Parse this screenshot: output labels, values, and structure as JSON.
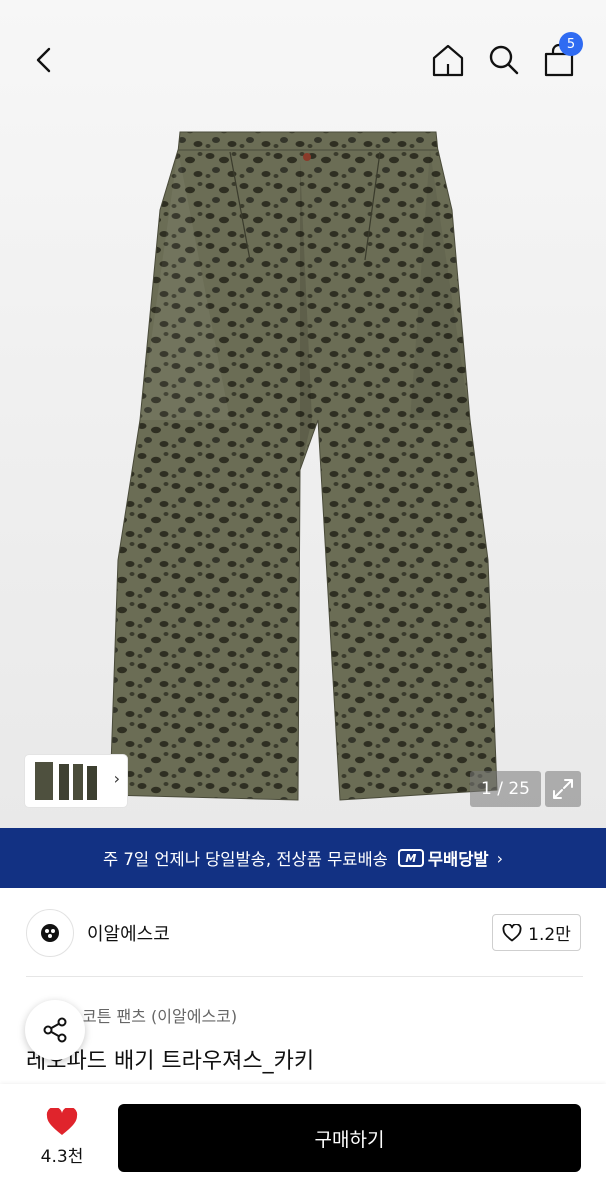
{
  "header": {
    "cart_count": "5"
  },
  "gallery": {
    "counter": "1 / 25"
  },
  "promo": {
    "text": "주 7일 언제나 당일발송, 전상품 무료배송",
    "badge_label": "무배당발"
  },
  "brand": {
    "name": "이알에스코",
    "likes": "1.2만"
  },
  "product": {
    "category": "코튼 팬츠 (이알에스코)",
    "title": "레오파드 배기 트라우져스_카키"
  },
  "bottom_bar": {
    "like_count": "4.3천",
    "buy_label": "구매하기"
  },
  "colors": {
    "promo_bg": "#123183",
    "badge": "#2f6bf2",
    "heart": "#e0242c",
    "buy_bg": "#000000"
  }
}
